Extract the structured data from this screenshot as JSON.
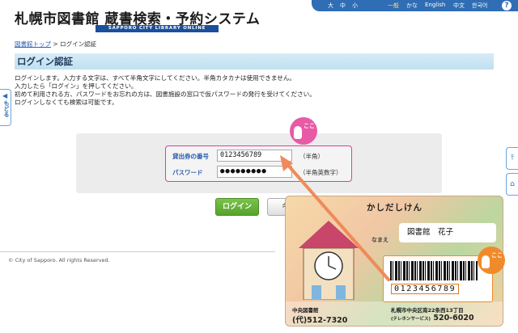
{
  "header": {
    "title_part1": "札幌市図書館",
    "title_part2": "蔵書検索・予約システム",
    "subtitle": "SAPPORO CITY LIBRARY ONLINE CATALOG",
    "font_sizes": [
      "大",
      "中",
      "小"
    ],
    "languages": [
      "一般",
      "かな",
      "English",
      "中文",
      "한국어"
    ],
    "help": "?"
  },
  "breadcrumb": {
    "home": "図書館トップ",
    "sep": ">",
    "current": "ログイン認証"
  },
  "page_title": "ログイン認証",
  "intro": {
    "line1": "ログインします。入力する文字は、すべて半角文字にしてください。半角カタカナは使用できません。",
    "line2": "入力したら「ログイン」を押してください。",
    "line3": "初めて利用される方、パスワードをお忘れの方は、図書施設の窓口で仮パスワードの発行を受けてください。",
    "line4": "ログインしなくても検索は可能です。"
  },
  "side_tab": {
    "label": "もどる"
  },
  "form": {
    "card_label": "貸出券の番号",
    "card_value": "0123456789",
    "card_hint": "（半角）",
    "password_label": "パスワード",
    "password_value": "●●●●●●●●●",
    "password_hint": "（半角英数字）"
  },
  "buttons": {
    "login": "ログイン",
    "cancel": "キャ"
  },
  "footer": {
    "copyright": "© City of Sapporo. All rights Reserved."
  },
  "badges": {
    "tap_text": "ここ"
  },
  "card": {
    "heading": "かしだしけん",
    "name_label": "なまえ",
    "name_value": "図書館　花子",
    "number": "0123456789",
    "branch": "中央図書館",
    "phone1": "(代)512-7320",
    "address": "札幌市中央区南22条西13丁目",
    "service_label": "(テレホンサービス)",
    "phone2": "520-6020"
  },
  "colors": {
    "accent_pink": "#d4449a",
    "accent_orange": "#f08a2a",
    "brand_blue": "#2f6db5",
    "login_green": "#55a22c"
  }
}
